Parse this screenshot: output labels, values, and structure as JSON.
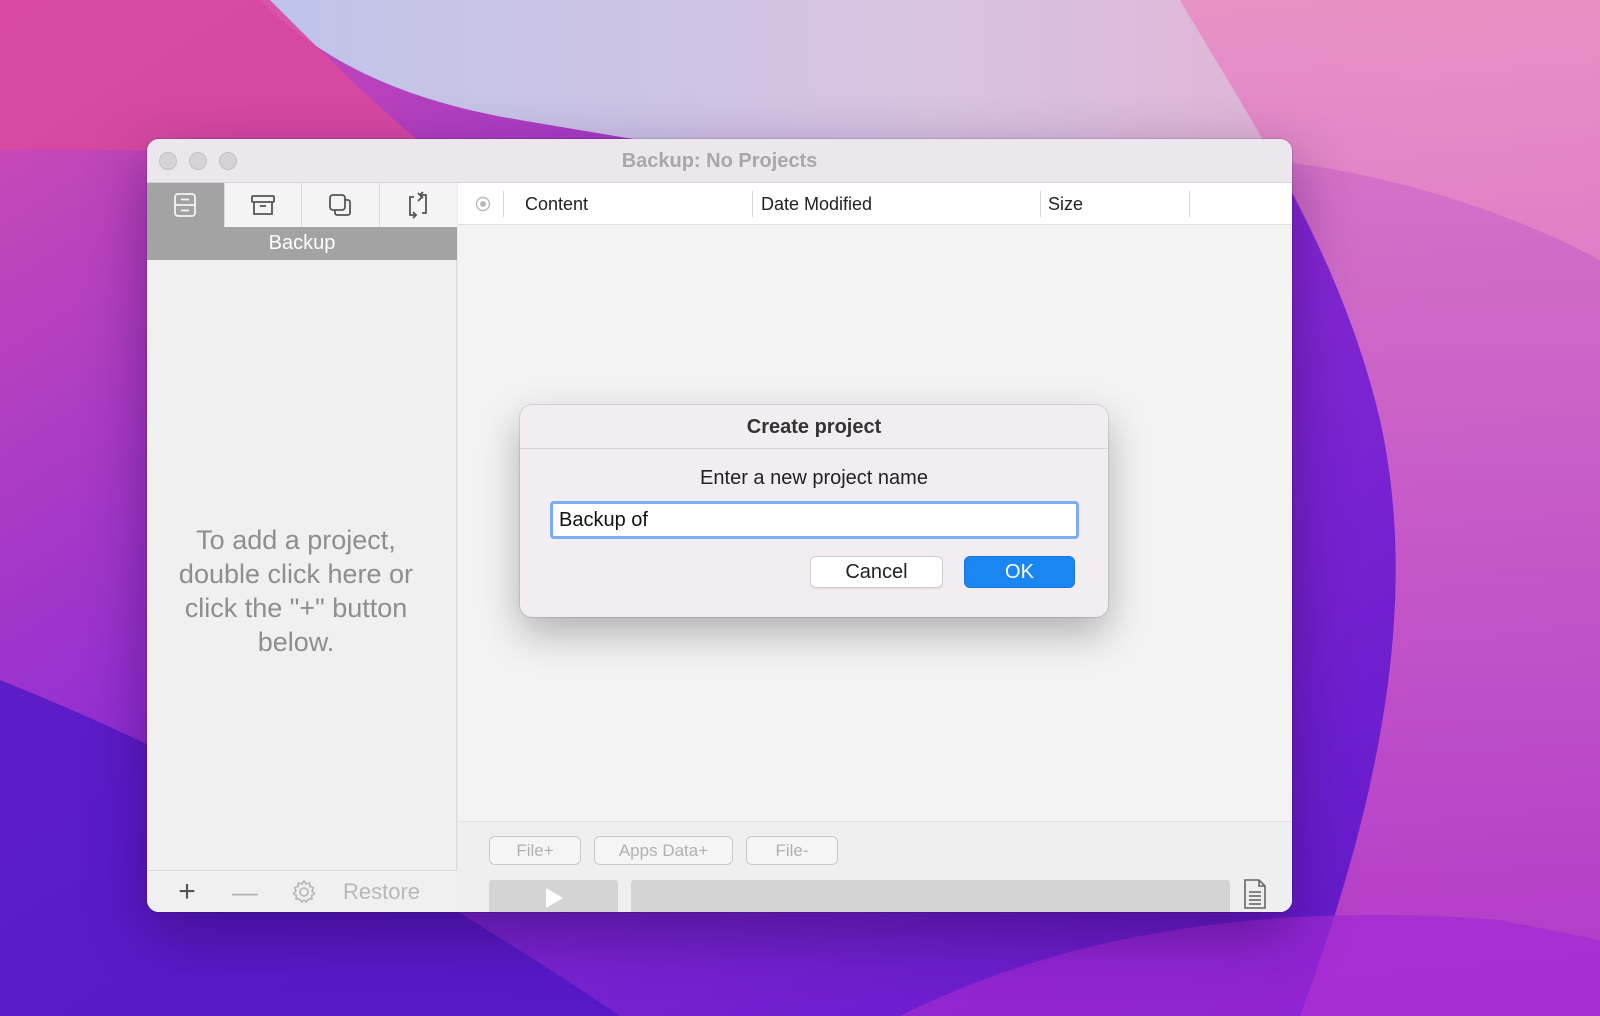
{
  "window": {
    "title": "Backup: No Projects"
  },
  "sidebar": {
    "tabs": [
      {
        "icon": "backup-list-icon",
        "active": true
      },
      {
        "icon": "archive-box-icon",
        "active": false
      },
      {
        "icon": "duplicate-icon",
        "active": false
      },
      {
        "icon": "sync-arrows-icon",
        "active": false
      }
    ],
    "active_tab_caption": "Backup",
    "empty_hint": "To add a project, double click here or click the \"+\" button below.",
    "footer": {
      "add_label": "+",
      "remove_label": "—",
      "restore_label": "Restore"
    }
  },
  "table": {
    "columns": [
      "Content",
      "Date Modified",
      "Size"
    ]
  },
  "actions": {
    "file_add": "File+",
    "apps_data_add": "Apps Data+",
    "file_remove": "File-"
  },
  "dialog": {
    "title": "Create project",
    "prompt": "Enter a new project name",
    "input_value": "Backup of",
    "cancel_label": "Cancel",
    "ok_label": "OK"
  },
  "colors": {
    "accent": "#1a86f2",
    "focus_ring": "#7aaef2",
    "active_tab": "#a3a3a3"
  }
}
